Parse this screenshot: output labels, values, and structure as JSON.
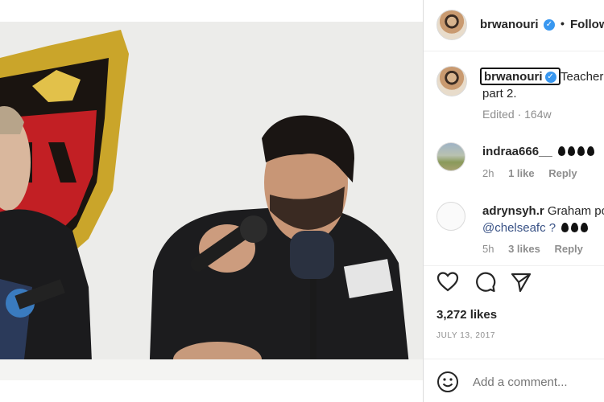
{
  "post": {
    "username": "brwanouri",
    "follow_label": "Follow",
    "separator": "•",
    "caption_text": "Teacher",
    "caption_line2": "part 2.",
    "caption_meta": "Edited · 164w",
    "likes": "3,272 likes",
    "date": "JULY 13, 2017",
    "add_comment_placeholder": "Add a comment..."
  },
  "comments": [
    {
      "username": "indraa666__",
      "time": "2h",
      "likes": "1 like",
      "reply": "Reply"
    },
    {
      "username": "adrynsyh.r",
      "text": "Graham po",
      "line2": "@chelseafc ?",
      "time": "5h",
      "likes": "3 likes",
      "reply": "Reply"
    }
  ],
  "icons": {
    "like": "heart-icon",
    "comment": "comment-bubble-icon",
    "share": "paper-plane-icon",
    "emoji": "smiley-icon",
    "verified": "verified-badge-icon"
  },
  "colors": {
    "verified": "#3897f0",
    "muted": "#8e8e8e",
    "text": "#262626",
    "mention": "#385185"
  }
}
